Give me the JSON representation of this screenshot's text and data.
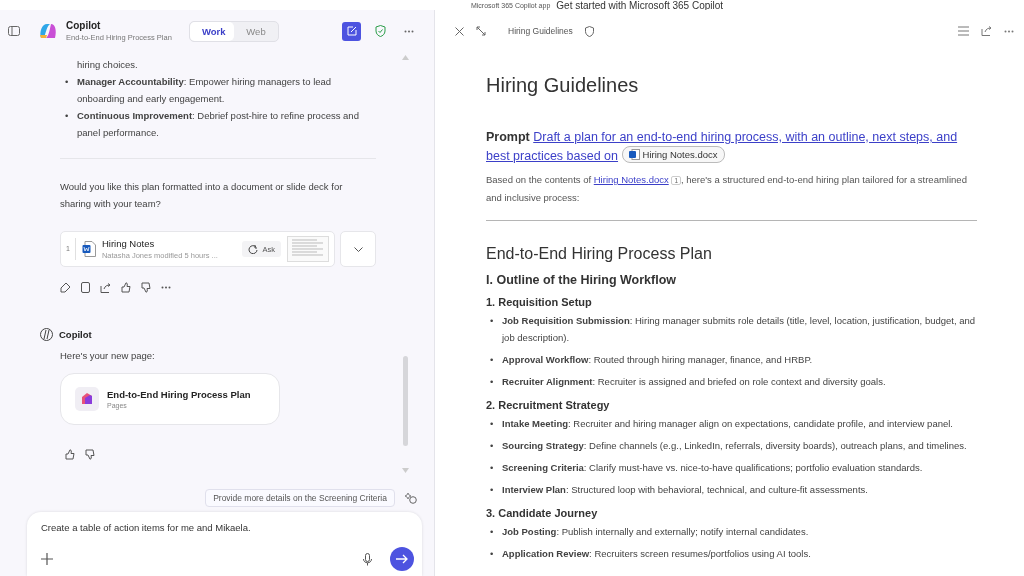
{
  "top_strip": {
    "app_name": "Microsoft 365 Copilot app",
    "title": "Get started with Microsoft 365 Copilot"
  },
  "chat": {
    "header": {
      "title": "Copilot",
      "subtitle": "End-to-End Hiring Process Plan",
      "modes": [
        {
          "label": "Work",
          "selected": true
        },
        {
          "label": "Web",
          "selected": false
        }
      ]
    },
    "continued_text": "hiring choices.",
    "bullets": [
      {
        "marker": "•",
        "text": "**Manager Accountability**: Empower hiring managers to lead onboarding and early engagement."
      },
      {
        "marker": "•",
        "text": "**Continuous Improvement**: Debrief post-hire to refine process and panel performance."
      }
    ],
    "question": "Would you like this plan formatted into a document or slide deck for sharing with your team?",
    "reference": {
      "index": "1",
      "title": "Hiring Notes",
      "meta": "Natasha Jones modified 5 hours ...",
      "ask": "Ask"
    },
    "copilot_label": "Copilot",
    "reply": "Here's your new page:",
    "page_card": {
      "title": "End-to-End Hiring Process Plan",
      "app": "Pages"
    },
    "suggestion": "Provide more details on the Screening Criteria",
    "composer": {
      "value": "Create a table of action items for me and Mikaela."
    }
  },
  "page": {
    "toolbar_title": "Hiring Guidelines",
    "title": "Hiring Guidelines",
    "prompt_label": "Prompt",
    "prompt_link": "Draft a plan for an end-to-end hiring process, with an outline, next steps, and best practices based on",
    "attachment": "Hiring Notes.docx",
    "intro_before": "Based on the contents of",
    "intro_link": "Hiring Notes.docx",
    "citation": "1",
    "intro_after": ", here's a structured end-to-end hiring plan tailored for a streamlined and inclusive process:",
    "plan_title": "End-to-End Hiring Process Plan",
    "outline_title": "I. Outline of the Hiring Workflow",
    "sections": [
      {
        "heading": "1. Requisition Setup",
        "items": [
          {
            "marker": "•",
            "text": "**Job Requisition Submission**: Hiring manager submits role details (title, level, location, justification, budget, and job description)."
          },
          {
            "marker": "•",
            "text": "**Approval Workflow**: Routed through hiring manager, finance, and HRBP."
          },
          {
            "marker": "•",
            "text": "**Recruiter Alignment**: Recruiter is assigned and briefed on role context and diversity goals."
          }
        ]
      },
      {
        "heading": "2. Recruitment Strategy",
        "items": [
          {
            "marker": "•",
            "text": "**Intake Meeting**: Recruiter and hiring manager align on expectations, candidate profile, and interview panel."
          },
          {
            "marker": "•",
            "text": "**Sourcing Strategy**: Define channels (e.g., LinkedIn, referrals, diversity boards), outreach plans, and timelines."
          },
          {
            "marker": "•",
            "text": "**Screening Criteria**: Clarify must-have vs. nice-to-have qualifications; portfolio evaluation standards."
          },
          {
            "marker": "•",
            "text": "**Interview Plan**: Structured loop with behavioral, technical, and culture-fit assessments."
          }
        ]
      },
      {
        "heading": "3. Candidate Journey",
        "items": [
          {
            "marker": "•",
            "text": "**Job Posting**: Publish internally and externally; notify internal candidates."
          },
          {
            "marker": "•",
            "text": "**Application Review**: Recruiters screen resumes/portfolios using AI tools."
          }
        ]
      }
    ]
  }
}
